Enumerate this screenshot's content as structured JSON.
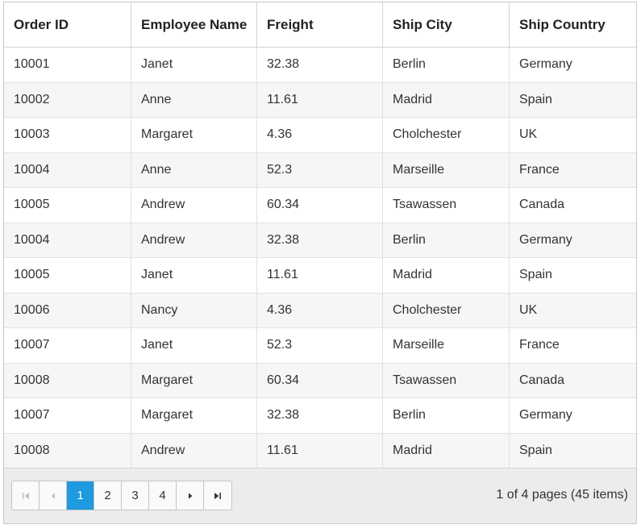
{
  "columns": [
    "Order ID",
    "Employee Name",
    "Freight",
    "Ship City",
    "Ship Country"
  ],
  "rows": [
    [
      "10001",
      "Janet",
      "32.38",
      "Berlin",
      "Germany"
    ],
    [
      "10002",
      "Anne",
      "11.61",
      "Madrid",
      "Spain"
    ],
    [
      "10003",
      "Margaret",
      "4.36",
      "Cholchester",
      "UK"
    ],
    [
      "10004",
      "Anne",
      "52.3",
      "Marseille",
      "France"
    ],
    [
      "10005",
      "Andrew",
      "60.34",
      "Tsawassen",
      "Canada"
    ],
    [
      "10004",
      "Andrew",
      "32.38",
      "Berlin",
      "Germany"
    ],
    [
      "10005",
      "Janet",
      "11.61",
      "Madrid",
      "Spain"
    ],
    [
      "10006",
      "Nancy",
      "4.36",
      "Cholchester",
      "UK"
    ],
    [
      "10007",
      "Janet",
      "52.3",
      "Marseille",
      "France"
    ],
    [
      "10008",
      "Margaret",
      "60.34",
      "Tsawassen",
      "Canada"
    ],
    [
      "10007",
      "Margaret",
      "32.38",
      "Berlin",
      "Germany"
    ],
    [
      "10008",
      "Andrew",
      "11.61",
      "Madrid",
      "Spain"
    ]
  ],
  "pager": {
    "pages": [
      "1",
      "2",
      "3",
      "4"
    ],
    "current_page": "1",
    "info": "1 of 4 pages (45 items)",
    "icons": {
      "first": "first-page-icon",
      "prev": "previous-page-icon",
      "next": "next-page-icon",
      "last": "last-page-icon"
    },
    "active_color": "#1e9ae0"
  }
}
